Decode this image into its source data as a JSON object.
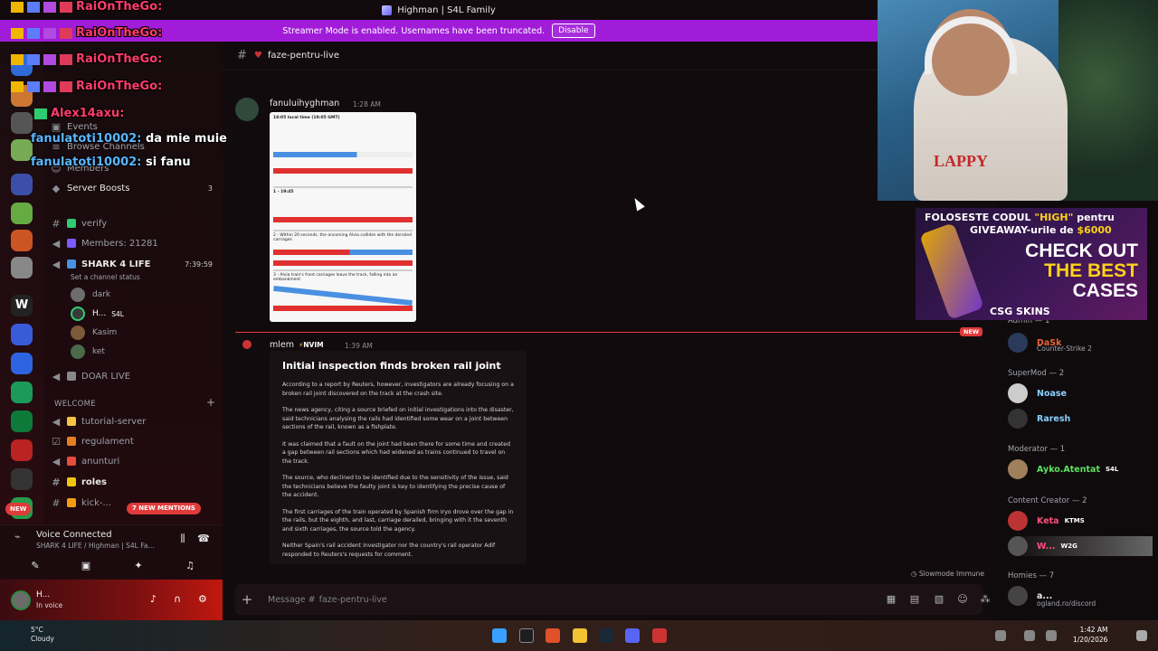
{
  "window": {
    "title": "Highman | S4L Family"
  },
  "streamer_banner": {
    "text": "Streamer Mode is enabled. Usernames have been truncated.",
    "button": "Disable"
  },
  "overlay_chat": [
    {
      "name": "RaiOnTheGo:",
      "text": ""
    },
    {
      "name": "RaiOnTheGo:",
      "text": ""
    },
    {
      "name": "RaiOnTheGo:",
      "text": ""
    },
    {
      "name": "RaiOnTheGo:",
      "text": ""
    },
    {
      "name": "Alex14axu:",
      "text": ""
    },
    {
      "name": "fanulatoti10002:",
      "text": "da mie muie"
    },
    {
      "name": "fanulatoti10002:",
      "text": "si fanu"
    }
  ],
  "sidebar": {
    "events": "Events",
    "browse": "Browse Channels",
    "members_label": "Members",
    "boosts": {
      "label": "Server Boosts",
      "count": "3"
    },
    "channels": [
      {
        "label": "verify"
      },
      {
        "label": "Members: 21281"
      }
    ],
    "voice_channel": {
      "label": "SHARK 4 LIFE",
      "timer": "7:39:59",
      "status": "Set a channel status"
    },
    "voice_users": [
      "dark",
      "H...",
      "Kasim",
      "ket"
    ],
    "voice_user_tag": "S4L",
    "doar_live": "DOAR LIVE",
    "welcome_category": "WELCOME",
    "welcome_channels": [
      "tutorial-server",
      "regulament",
      "anunturi",
      "roles",
      "kick-..."
    ],
    "new_mentions": "7 NEW MENTIONS",
    "new_pill": "NEW",
    "voice_connected": {
      "title": "Voice Connected",
      "subtitle": "SHARK 4 LIFE / Highman | S4L Fa..."
    },
    "user": {
      "name": "H...",
      "status": "In voice"
    }
  },
  "main": {
    "channel": "faze-pentru-live",
    "msg1": {
      "author": "fanuluihyghman",
      "time": "1:28 AM",
      "infographic": {
        "header": "18:05 local time (19:05 GMT)",
        "step1": "1 - 19:45",
        "step2": "2 - Within 20 seconds, the oncoming Alvia collides with the derailed carriages",
        "step3": "3 - Alvia train's front carriages leave the track, falling into an embankment"
      }
    },
    "new_tag": "NEW",
    "msg2": {
      "author": "mlem",
      "role": "NVIM",
      "time": "1:39 AM",
      "embed": {
        "title": "Initial inspection finds broken rail joint",
        "paragraphs": [
          "According to a report by Reuters, however, investigators are already focusing on a broken rail joint discovered on the track at the crash site.",
          "The news agency, citing a source briefed on initial investigations into the disaster, said technicians analysing the rails had identified some wear on a joint between sections of the rail, known as a fishplate.",
          "It was claimed that a fault on the joint had been there for some time and created a gap between rail sections which had widened as trains continued to travel on the track.",
          "The source, who declined to be identified due to the sensitivity of the issue, said the technicians believe the faulty joint is key to identifying the precise cause of the accident.",
          "The first carriages of the train operated by Spanish firm Iryo drove over the gap in the rails, but the eighth, and last, carriage derailed, bringing with it the seventh and sixth carriages, the source told the agency.",
          "Neither Spain's rail accident investigator nor the country's rail operator Adif responded to Reuters's requests for comment."
        ]
      }
    },
    "slowmode": "Slowmode Immune",
    "input_placeholder": "Message #",
    "input_channel": "faze-pentru-live"
  },
  "members": {
    "admin_cat": "Admin — 1",
    "admin": {
      "name": "DaSk",
      "sub": "Counter-Strike 2"
    },
    "supermod_cat": "SuperMod — 2",
    "supermods": [
      "Noase",
      "Raresh"
    ],
    "moderator_cat": "Moderator — 1",
    "moderator": {
      "name": "Ayko.Atentat",
      "tag": "S4L"
    },
    "creator_cat": "Content Creator — 2",
    "creators": [
      {
        "name": "Keta",
        "tag": "KTMS"
      },
      {
        "name": "W...",
        "tag": "W2G"
      }
    ],
    "homies_cat": "Homies — 7",
    "homie": {
      "name": "a...",
      "sub": "ogland.ro/discord"
    }
  },
  "ad": {
    "line1a": "FOLOSESTE CODUL ",
    "line1b": "\"HIGH\"",
    "line1c": " pentru",
    "line2a": "GIVEAWAY-urile de ",
    "line2b": "$6000",
    "check": "CHECK OUT",
    "best": "THE BEST",
    "cases": "CASES",
    "brand": "CSG SKINS"
  },
  "webcam": {
    "shirt_text": "LAPPY"
  },
  "taskbar": {
    "weather_temp": "5°C",
    "weather_text": "Cloudy",
    "time": "1:42 AM",
    "date": "1/20/2026"
  }
}
